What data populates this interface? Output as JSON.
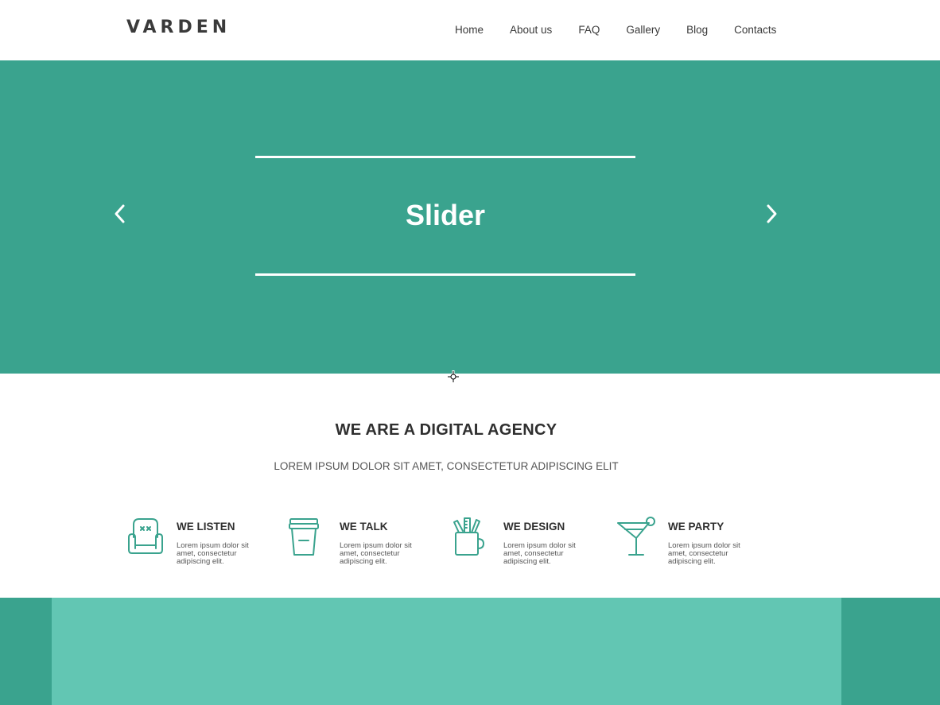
{
  "header": {
    "logo": "VARDEN",
    "nav": [
      "Home",
      "About us",
      "FAQ",
      "Gallery",
      "Blog",
      "Contacts"
    ]
  },
  "hero": {
    "title": "Slider",
    "prev_icon": "chevron-left-icon",
    "next_icon": "chevron-right-icon"
  },
  "about": {
    "title": "WE ARE A DIGITAL AGENCY",
    "subtitle": "LOREM IPSUM DOLOR SIT AMET, CONSECTETUR ADIPISCING ELIT"
  },
  "features": [
    {
      "icon": "armchair-icon",
      "title": "WE LISTEN",
      "text": "Lorem ipsum dolor sit amet, consectetur adipiscing elit."
    },
    {
      "icon": "coffee-cup-icon",
      "title": "WE TALK",
      "text": "Lorem ipsum dolor sit amet, consectetur adipiscing elit."
    },
    {
      "icon": "pencil-cup-icon",
      "title": "WE DESIGN",
      "text": "Lorem ipsum dolor sit amet, consectetur adipiscing elit."
    },
    {
      "icon": "cocktail-icon",
      "title": "WE PARTY",
      "text": "Lorem ipsum dolor sit amet, consectetur adipiscing elit."
    }
  ],
  "colors": {
    "accent": "#3aa38e",
    "accent_light": "#62c6b3",
    "text": "#333333"
  }
}
